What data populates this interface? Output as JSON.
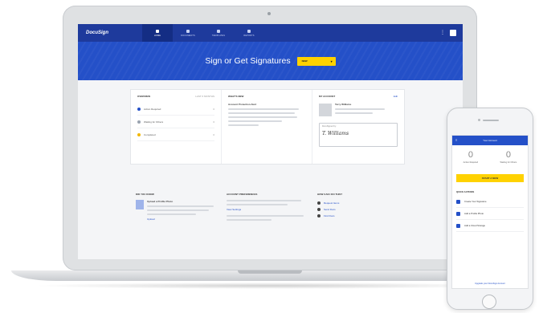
{
  "app": {
    "brand": "DocuSign",
    "nav_tabs": [
      {
        "label": "HOME",
        "active": true
      },
      {
        "label": "DOCUMENTS",
        "active": false
      },
      {
        "label": "TEMPLATES",
        "active": false
      },
      {
        "label": "REPORTS",
        "active": false
      }
    ],
    "menu_glyph": "⋮"
  },
  "hero": {
    "title": "Sign or Get Signatures",
    "button_label": "NEW",
    "caret": "▾"
  },
  "overview": {
    "overview_title": "OVERVIEW",
    "overview_range": "LAST 6 MONTHS",
    "stats": [
      {
        "label": "Action Required",
        "count": "0",
        "color": "#2450c8"
      },
      {
        "label": "Waiting for Others",
        "count": "0",
        "color": "#9aa3b0"
      },
      {
        "label": "Completed",
        "count": "0",
        "color": "#f2b705"
      }
    ],
    "whats_new_title": "WHAT'S NEW",
    "whats_new_heading": "Account Protection Alert",
    "my_account_title": "MY ACCOUNT",
    "edit_label": "Edit",
    "profile_name": "Terry Williams",
    "sig_caption": "DocuSigned by:",
    "sig_text": "T. Williams"
  },
  "helper": {
    "col1_title": "DID YOU KNOW",
    "col1_tip": "Upload a Profile Photo",
    "col1_link": "Upload",
    "col2_title": "ACCOUNT PREFERENCES",
    "col2_link": "View Settings",
    "col3_title": "HOW CAN I DO THIS?",
    "col3_items": [
      "Request Items",
      "Send Docs",
      "Find Docs"
    ]
  },
  "phone": {
    "title": "Your Account",
    "menu_glyph": "≡",
    "stats": [
      {
        "value": "0",
        "label": "Action Required"
      },
      {
        "value": "0",
        "label": "Waiting for Others"
      }
    ],
    "button_label": "START A NEW",
    "quick_title": "QUICK ACTIONS",
    "quick_actions": [
      "Create Your Signature",
      "Add a Profile Photo",
      "Add a Cloud Storage"
    ],
    "footer_link": "Upgrade your DocuSign Account"
  }
}
